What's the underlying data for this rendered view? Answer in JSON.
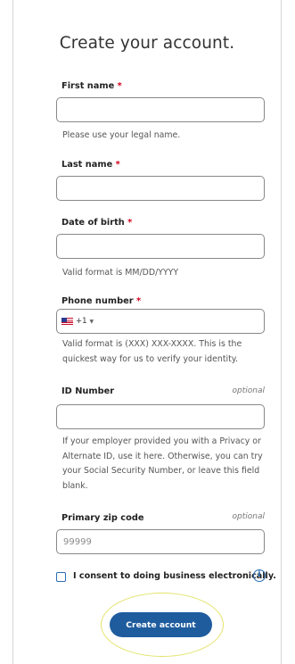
{
  "form": {
    "title": "Create your account.",
    "required_mark": "*",
    "optional_label": "optional",
    "first_name": {
      "label": "First name",
      "value": "",
      "help": "Please use your legal name."
    },
    "last_name": {
      "label": "Last name",
      "value": ""
    },
    "dob": {
      "label": "Date of birth",
      "value": "",
      "help": "Valid format is MM/DD/YYYY"
    },
    "phone": {
      "label": "Phone number",
      "country_flag": "us-flag-icon",
      "country_code": "+1",
      "value": "",
      "help_line1": "Valid format is (XXX) XXX-XXXX. This is the",
      "help_line2": "quickest way for us to verify your identity."
    },
    "id_number": {
      "label": "ID Number",
      "value": "",
      "help_lines": [
        "If your employer provided you with a Privacy or",
        "Alternate ID, use it here. Otherwise, you can try",
        "your Social Security Number, or leave this field",
        "blank."
      ]
    },
    "zip": {
      "label": "Primary zip code",
      "value": "",
      "placeholder": "99999"
    },
    "consent": {
      "label": "I consent to doing business electronically.",
      "checked": false,
      "info_icon": "info-icon"
    },
    "submit_label": "Create account"
  },
  "colors": {
    "primary_button": "#1f5c9e",
    "required": "#d0021b",
    "checkbox_accent": "#2a6db5",
    "highlight_ring": "#e3e36b"
  }
}
